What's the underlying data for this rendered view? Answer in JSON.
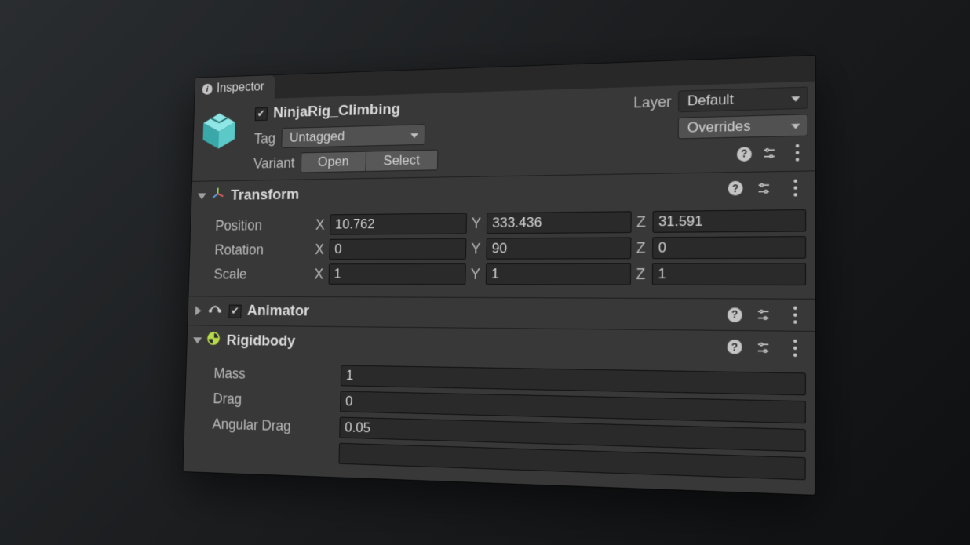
{
  "tab": {
    "title": "Inspector"
  },
  "header": {
    "object_name": "NinjaRig_Climbing",
    "layer_label": "Layer",
    "layer_value": "Default",
    "tag_label": "Tag",
    "tag_value": "Untagged",
    "overrides_label": "Overrides",
    "variant_label": "Variant",
    "open_btn": "Open",
    "select_btn": "Select"
  },
  "transform": {
    "title": "Transform",
    "position_label": "Position",
    "rotation_label": "Rotation",
    "scale_label": "Scale",
    "position": {
      "x": "10.762",
      "y": "333.436",
      "z": "31.591"
    },
    "rotation": {
      "x": "0",
      "y": "90",
      "z": "0"
    },
    "scale": {
      "x": "1",
      "y": "1",
      "z": "1"
    },
    "axis": {
      "x": "X",
      "y": "Y",
      "z": "Z"
    }
  },
  "animator": {
    "title": "Animator"
  },
  "rigidbody": {
    "title": "Rigidbody",
    "mass_label": "Mass",
    "mass": "1",
    "drag_label": "Drag",
    "drag": "0",
    "angular_drag_label": "Angular Drag",
    "angular_drag": "0.05"
  }
}
